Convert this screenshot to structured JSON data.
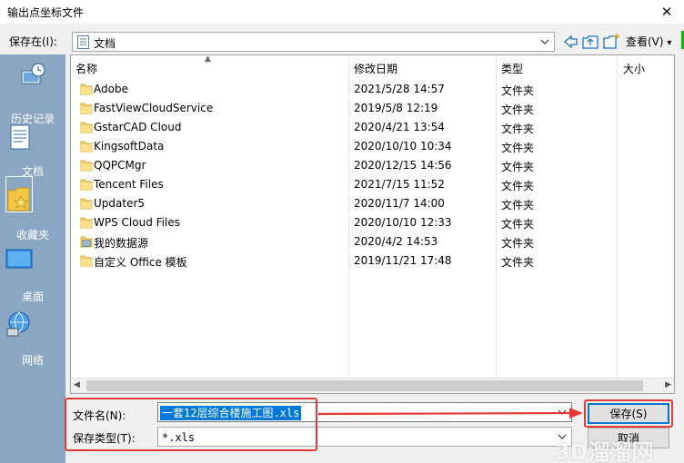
{
  "window": {
    "title": "输出点坐标文件"
  },
  "toolbar": {
    "save_in_label": "保存在(I):",
    "save_in_value": "文档",
    "view_label": "查看(V)"
  },
  "places": [
    {
      "label": "历史记录",
      "icon": "history-icon"
    },
    {
      "label": "文档",
      "icon": "documents-icon"
    },
    {
      "label": "收藏夹",
      "icon": "favorites-icon"
    },
    {
      "label": "桌面",
      "icon": "desktop-icon"
    },
    {
      "label": "网络",
      "icon": "network-icon"
    }
  ],
  "columns": {
    "name": "名称",
    "date": "修改日期",
    "type": "类型",
    "size": "大小"
  },
  "files": [
    {
      "name": "Adobe",
      "date": "2021/5/28 14:57",
      "type": "文件夹",
      "icon": "folder-icon"
    },
    {
      "name": "FastViewCloudService",
      "date": "2019/5/8 12:19",
      "type": "文件夹",
      "icon": "folder-icon"
    },
    {
      "name": "GstarCAD Cloud",
      "date": "2020/4/21 13:54",
      "type": "文件夹",
      "icon": "folder-icon"
    },
    {
      "name": "KingsoftData",
      "date": "2020/10/10 10:34",
      "type": "文件夹",
      "icon": "folder-icon"
    },
    {
      "name": "QQPCMgr",
      "date": "2020/12/15 14:56",
      "type": "文件夹",
      "icon": "folder-icon"
    },
    {
      "name": "Tencent Files",
      "date": "2021/7/15 11:52",
      "type": "文件夹",
      "icon": "folder-icon"
    },
    {
      "name": "Updater5",
      "date": "2020/11/7 14:00",
      "type": "文件夹",
      "icon": "folder-icon"
    },
    {
      "name": "WPS Cloud Files",
      "date": "2020/10/10 12:33",
      "type": "文件夹",
      "icon": "folder-icon"
    },
    {
      "name": "我的数据源",
      "date": "2020/4/2 14:53",
      "type": "文件夹",
      "icon": "data-source-folder-icon"
    },
    {
      "name": "自定义 Office 模板",
      "date": "2019/11/21 17:48",
      "type": "文件夹",
      "icon": "folder-icon"
    }
  ],
  "form": {
    "filename_label": "文件名(N):",
    "filename_value": "一套12层综合楼施工图.xls",
    "filetype_label": "保存类型(T):",
    "filetype_value": "*.xls",
    "save_button": "保存(S)",
    "cancel_button": "取消"
  },
  "watermark": "3D溜溜网",
  "colors": {
    "places_bg": "#8aa6c2",
    "selection": "#0078d7",
    "annotation_red": "#e53935"
  }
}
